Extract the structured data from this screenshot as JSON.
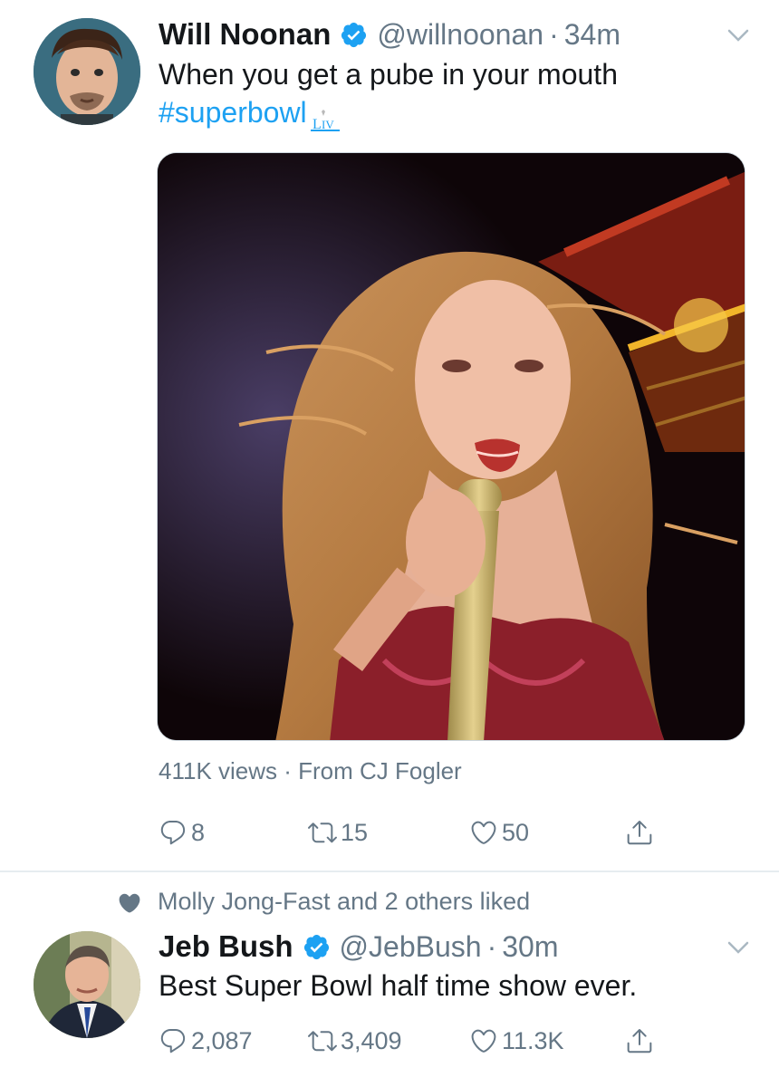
{
  "colors": {
    "accent": "#1da1f2",
    "secondary_text": "#657786",
    "primary_text": "#14171a",
    "divider": "#e6ecf0"
  },
  "tweets": [
    {
      "name": "Will Noonan",
      "handle": "@willnoonan",
      "time": "34m",
      "text_line1": "When you get a pube in your mouth",
      "hashtag": "#superbowl",
      "media_caption": "411K views · From CJ Fogler",
      "actions": {
        "replies": "8",
        "retweets": "15",
        "likes": "50"
      },
      "icons": [
        "verified-icon",
        "chevron-down-icon",
        "reply-icon",
        "retweet-icon",
        "like-icon",
        "share-icon",
        "superbowl-liv-hashflag-icon"
      ]
    },
    {
      "social_context": "Molly Jong-Fast and 2 others liked",
      "name": "Jeb Bush",
      "handle": "@JebBush",
      "time": "30m",
      "text": "Best Super Bowl half time show ever.",
      "actions": {
        "replies": "2,087",
        "retweets": "3,409",
        "likes": "11.3K"
      },
      "icons": [
        "heart-icon",
        "verified-icon",
        "chevron-down-icon",
        "reply-icon",
        "retweet-icon",
        "like-icon",
        "share-icon"
      ]
    }
  ]
}
